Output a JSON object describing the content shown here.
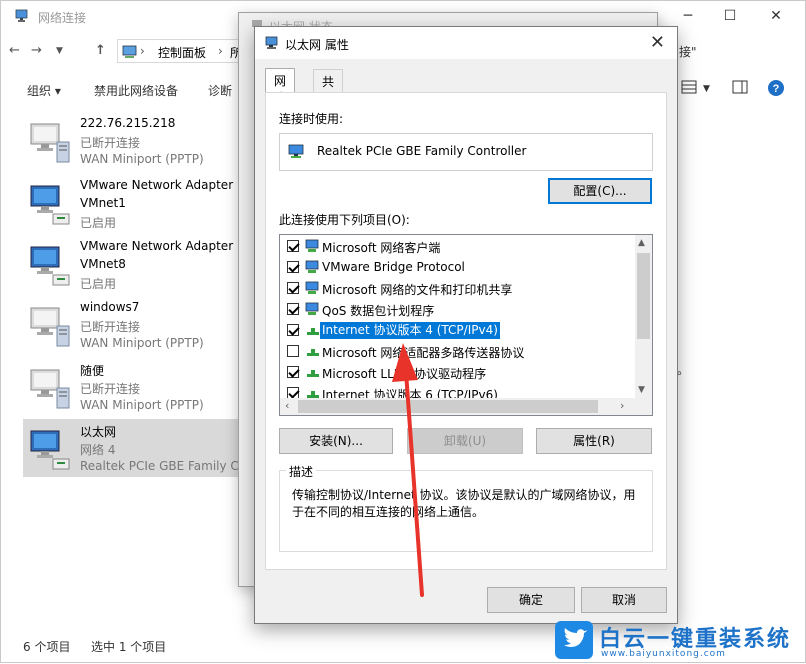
{
  "explorer": {
    "title": "网络连接",
    "breadcrumb": [
      "控制面板",
      "所"
    ],
    "search_placeholder": "接\"",
    "toolbar": {
      "organize": "组织 ▾",
      "disable_device": "禁用此网络设备",
      "diagnose": "诊断"
    },
    "items": [
      {
        "name": "222.76.215.218",
        "status": "已断开连接",
        "device": "WAN Miniport (PPTP)",
        "type": "wan"
      },
      {
        "name": "VMware Network Adapter",
        "status": "VMnet1",
        "device": "已启用",
        "type": "lan"
      },
      {
        "name": "VMware Network Adapter",
        "status": "VMnet8",
        "device": "已启用",
        "type": "lan"
      },
      {
        "name": "windows7",
        "status": "已断开连接",
        "device": "WAN Miniport (PPTP)",
        "type": "wan"
      },
      {
        "name": "随便",
        "status": "已断开连接",
        "device": "WAN Miniport (PPTP)",
        "type": "wan"
      },
      {
        "name": "以太网",
        "status": "网络 4",
        "device": "Realtek PCIe GBE Family Co",
        "type": "lan",
        "selected": true
      }
    ],
    "status_count": "6 个项目",
    "status_selected": "选中 1 个项目",
    "stray_text": "。"
  },
  "background_dialog": {
    "title": "以太网 状态"
  },
  "dialog": {
    "title": "以太网 属性",
    "close_glyph": "✕",
    "tabs": [
      "网络",
      "共享"
    ],
    "connect_using_label": "连接时使用:",
    "adapter": "Realtek PCIe GBE Family Controller",
    "configure_button": "配置(C)...",
    "items_label": "此连接使用下列项目(O):",
    "list_items": [
      {
        "label": "Microsoft 网络客户端",
        "checked": true,
        "icon": "network-client-icon"
      },
      {
        "label": "VMware Bridge Protocol",
        "checked": true,
        "icon": "protocol-icon"
      },
      {
        "label": "Microsoft 网络的文件和打印机共享",
        "checked": true,
        "icon": "file-share-icon"
      },
      {
        "label": "QoS 数据包计划程序",
        "checked": true,
        "icon": "protocol-icon"
      },
      {
        "label": "Internet 协议版本 4 (TCP/IPv4)",
        "checked": true,
        "icon": "protocol-green-icon",
        "selected": true
      },
      {
        "label": "Microsoft 网络适配器多路传送器协议",
        "checked": false,
        "icon": "protocol-green-icon"
      },
      {
        "label": "Microsoft LLDP 协议驱动程序",
        "checked": true,
        "icon": "protocol-green-icon"
      },
      {
        "label": "Internet 协议版本 6 (TCP/IPv6)",
        "checked": true,
        "icon": "protocol-green-icon"
      }
    ],
    "install_button": "安装(N)...",
    "uninstall_button": "卸载(U)",
    "properties_button": "属性(R)",
    "description_legend": "描述",
    "description_text": "传输控制协议/Internet 协议。该协议是默认的广域网络协议，用于在不同的相互连接的网络上通信。",
    "ok_button": "确定",
    "cancel_button": "取消"
  },
  "colors": {
    "accent": "#0078d7",
    "annotation": "#e8332a",
    "selection_bg": "#d9d9d9"
  },
  "watermark": {
    "brand": "白云一键重装系统",
    "url": "www.baiyunxitong.com"
  }
}
